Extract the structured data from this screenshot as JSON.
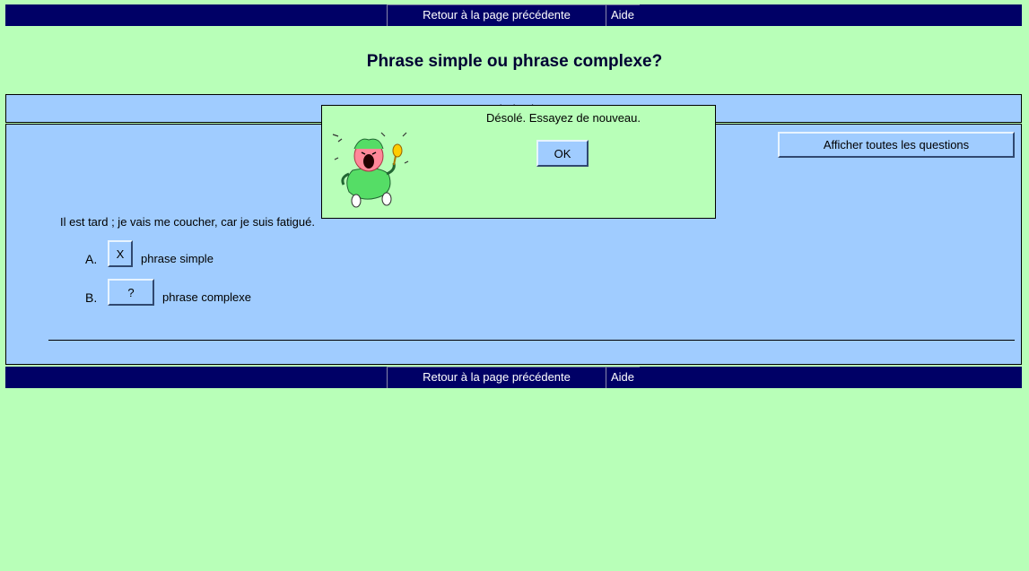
{
  "nav": {
    "back_label": "Retour à la page précédente",
    "help_label": "Aide"
  },
  "page": {
    "title": "Phrase simple ou phrase complexe?"
  },
  "header": {
    "text": "1/1 (0%)"
  },
  "toolbar": {
    "show_all_label": "Afficher toutes les questions"
  },
  "question": {
    "text": "Il est tard ; je vais me coucher, car je suis fatigué.",
    "options": [
      {
        "letter": "A.",
        "button": "X",
        "text": "phrase simple"
      },
      {
        "letter": "B.",
        "button": "?",
        "text": "phrase complexe"
      }
    ]
  },
  "dialog": {
    "message": "Désolé. Essayez de nouveau.",
    "ok_label": "OK",
    "icon": "crying-baby-icon"
  },
  "colors": {
    "background": "#b8ffb8",
    "panel": "#a0ccff",
    "navbar": "#000066"
  }
}
